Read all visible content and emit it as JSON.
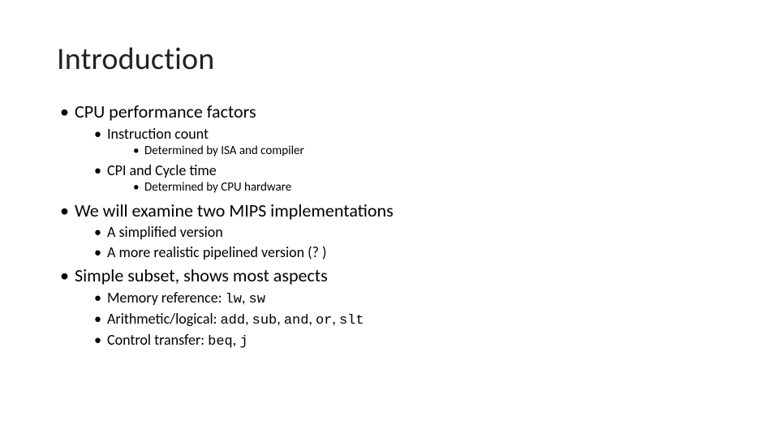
{
  "title": "Introduction",
  "b1": {
    "text": "CPU performance factors",
    "c1": {
      "text": "Instruction count",
      "d1": "Determined by ISA and compiler"
    },
    "c2": {
      "text": "CPI and Cycle time",
      "d1": "Determined by CPU hardware"
    }
  },
  "b2": {
    "text": "We will examine two MIPS implementations",
    "c1": "A simplified version",
    "c2": "A more realistic pipelined version (? )"
  },
  "b3": {
    "text": "Simple subset, shows most aspects",
    "c1": {
      "label": "Memory reference: ",
      "code": "lw",
      "sep1": ", ",
      "code2": "sw"
    },
    "c2": {
      "label": "Arithmetic/logical: ",
      "code": "add",
      "s1": ", ",
      "code2": "sub",
      "s2": ", ",
      "code3": "and",
      "s3": ", ",
      "code4": "or",
      "s4": ", ",
      "code5": "slt"
    },
    "c3": {
      "label": "Control transfer: ",
      "code": "beq",
      "s1": ", ",
      "code2": "j"
    }
  }
}
